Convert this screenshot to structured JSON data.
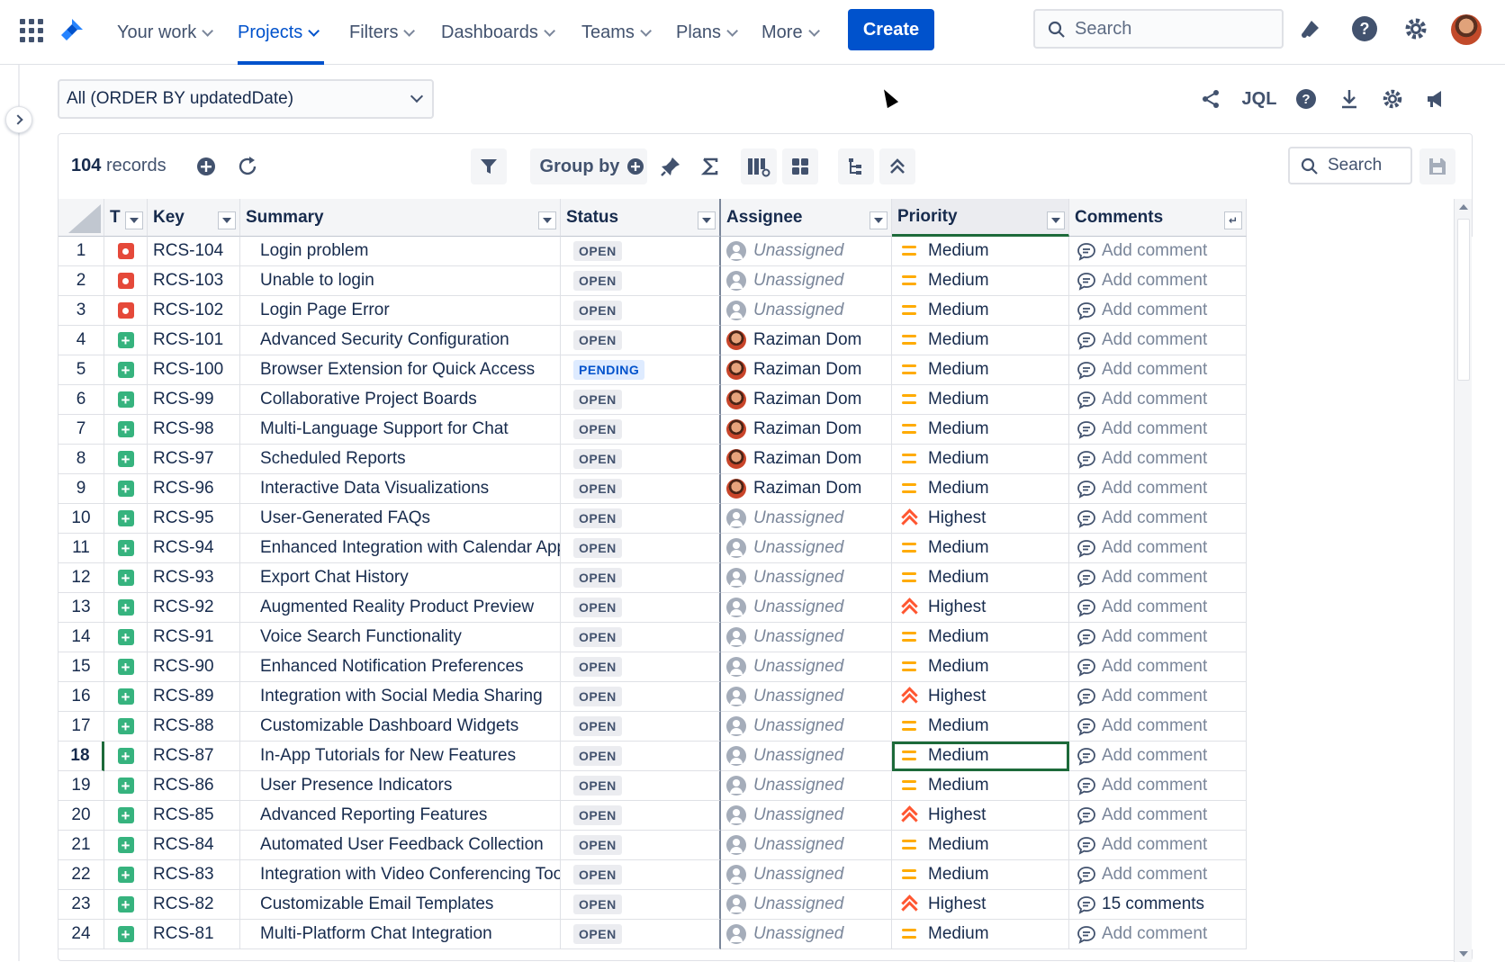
{
  "nav": {
    "items": [
      {
        "label": "Your work"
      },
      {
        "label": "Projects"
      },
      {
        "label": "Filters"
      },
      {
        "label": "Dashboards"
      },
      {
        "label": "Teams"
      },
      {
        "label": "Plans"
      },
      {
        "label": "More"
      }
    ],
    "active": "Projects",
    "create_label": "Create",
    "search_placeholder": "Search"
  },
  "filter": {
    "selected": "All (ORDER BY updatedDate)",
    "jql_label": "JQL"
  },
  "toolbar": {
    "records_count": "104",
    "records_label": "records",
    "group_by_label": "Group by",
    "search_placeholder": "Search"
  },
  "columns": {
    "type": "T",
    "key": "Key",
    "summary": "Summary",
    "status": "Status",
    "assignee": "Assignee",
    "priority": "Priority",
    "comments": "Comments"
  },
  "selected_row": 18,
  "rows": [
    {
      "n": "1",
      "type": "bug",
      "key": "RCS-104",
      "summary": "Login problem",
      "status": "OPEN",
      "assignee": "Unassigned",
      "priority": "Medium",
      "comments": "Add comment"
    },
    {
      "n": "2",
      "type": "bug",
      "key": "RCS-103",
      "summary": "Unable to login",
      "status": "OPEN",
      "assignee": "Unassigned",
      "priority": "Medium",
      "comments": "Add comment"
    },
    {
      "n": "3",
      "type": "bug",
      "key": "RCS-102",
      "summary": "Login Page Error",
      "status": "OPEN",
      "assignee": "Unassigned",
      "priority": "Medium",
      "comments": "Add comment"
    },
    {
      "n": "4",
      "type": "new-feature",
      "key": "RCS-101",
      "summary": "Advanced Security Configuration",
      "status": "OPEN",
      "assignee": "Raziman Dom",
      "priority": "Medium",
      "comments": "Add comment"
    },
    {
      "n": "5",
      "type": "new-feature",
      "key": "RCS-100",
      "summary": "Browser Extension for Quick Access",
      "status": "PENDING",
      "assignee": "Raziman Dom",
      "priority": "Medium",
      "comments": "Add comment"
    },
    {
      "n": "6",
      "type": "new-feature",
      "key": "RCS-99",
      "summary": "Collaborative Project Boards",
      "status": "OPEN",
      "assignee": "Raziman Dom",
      "priority": "Medium",
      "comments": "Add comment"
    },
    {
      "n": "7",
      "type": "new-feature",
      "key": "RCS-98",
      "summary": "Multi-Language Support for Chat",
      "status": "OPEN",
      "assignee": "Raziman Dom",
      "priority": "Medium",
      "comments": "Add comment"
    },
    {
      "n": "8",
      "type": "new-feature",
      "key": "RCS-97",
      "summary": "Scheduled Reports",
      "status": "OPEN",
      "assignee": "Raziman Dom",
      "priority": "Medium",
      "comments": "Add comment"
    },
    {
      "n": "9",
      "type": "new-feature",
      "key": "RCS-96",
      "summary": "Interactive Data Visualizations",
      "status": "OPEN",
      "assignee": "Raziman Dom",
      "priority": "Medium",
      "comments": "Add comment"
    },
    {
      "n": "10",
      "type": "new-feature",
      "key": "RCS-95",
      "summary": "User-Generated FAQs",
      "status": "OPEN",
      "assignee": "Unassigned",
      "priority": "Highest",
      "comments": "Add comment"
    },
    {
      "n": "11",
      "type": "new-feature",
      "key": "RCS-94",
      "summary": "Enhanced Integration with Calendar Apps",
      "status": "OPEN",
      "assignee": "Unassigned",
      "priority": "Medium",
      "comments": "Add comment"
    },
    {
      "n": "12",
      "type": "new-feature",
      "key": "RCS-93",
      "summary": "Export Chat History",
      "status": "OPEN",
      "assignee": "Unassigned",
      "priority": "Medium",
      "comments": "Add comment"
    },
    {
      "n": "13",
      "type": "new-feature",
      "key": "RCS-92",
      "summary": "Augmented Reality Product Preview",
      "status": "OPEN",
      "assignee": "Unassigned",
      "priority": "Highest",
      "comments": "Add comment"
    },
    {
      "n": "14",
      "type": "new-feature",
      "key": "RCS-91",
      "summary": "Voice Search Functionality",
      "status": "OPEN",
      "assignee": "Unassigned",
      "priority": "Medium",
      "comments": "Add comment"
    },
    {
      "n": "15",
      "type": "new-feature",
      "key": "RCS-90",
      "summary": "Enhanced Notification Preferences",
      "status": "OPEN",
      "assignee": "Unassigned",
      "priority": "Medium",
      "comments": "Add comment"
    },
    {
      "n": "16",
      "type": "new-feature",
      "key": "RCS-89",
      "summary": "Integration with Social Media Sharing",
      "status": "OPEN",
      "assignee": "Unassigned",
      "priority": "Highest",
      "comments": "Add comment"
    },
    {
      "n": "17",
      "type": "new-feature",
      "key": "RCS-88",
      "summary": "Customizable Dashboard Widgets",
      "status": "OPEN",
      "assignee": "Unassigned",
      "priority": "Medium",
      "comments": "Add comment"
    },
    {
      "n": "18",
      "type": "new-feature",
      "key": "RCS-87",
      "summary": "In-App Tutorials for New Features",
      "status": "OPEN",
      "assignee": "Unassigned",
      "priority": "Medium",
      "comments": "Add comment"
    },
    {
      "n": "19",
      "type": "new-feature",
      "key": "RCS-86",
      "summary": "User Presence Indicators",
      "status": "OPEN",
      "assignee": "Unassigned",
      "priority": "Medium",
      "comments": "Add comment"
    },
    {
      "n": "20",
      "type": "new-feature",
      "key": "RCS-85",
      "summary": "Advanced Reporting Features",
      "status": "OPEN",
      "assignee": "Unassigned",
      "priority": "Highest",
      "comments": "Add comment"
    },
    {
      "n": "21",
      "type": "new-feature",
      "key": "RCS-84",
      "summary": "Automated User Feedback Collection",
      "status": "OPEN",
      "assignee": "Unassigned",
      "priority": "Medium",
      "comments": "Add comment"
    },
    {
      "n": "22",
      "type": "new-feature",
      "key": "RCS-83",
      "summary": "Integration with Video Conferencing Tools",
      "status": "OPEN",
      "assignee": "Unassigned",
      "priority": "Medium",
      "comments": "Add comment"
    },
    {
      "n": "23",
      "type": "new-feature",
      "key": "RCS-82",
      "summary": "Customizable Email Templates",
      "status": "OPEN",
      "assignee": "Unassigned",
      "priority": "Highest",
      "comments": "15 comments"
    },
    {
      "n": "24",
      "type": "new-feature",
      "key": "RCS-81",
      "summary": "Multi-Platform Chat Integration",
      "status": "OPEN",
      "assignee": "Unassigned",
      "priority": "Medium",
      "comments": "Add comment"
    }
  ],
  "colors": {
    "brand": "#0052cc",
    "bug": "#e5493a",
    "new_feature": "#36b37e",
    "priority_medium": "#ffab00",
    "priority_highest": "#ff5630",
    "selection": "#1d6a3a"
  },
  "icons": {
    "type_bug": "bug-icon",
    "type_new_feature": "new-feature-icon",
    "priority_medium": "priority-medium-icon",
    "priority_highest": "priority-highest-icon",
    "comment": "comment-icon",
    "unassigned_avatar": "unassigned-avatar-icon"
  }
}
